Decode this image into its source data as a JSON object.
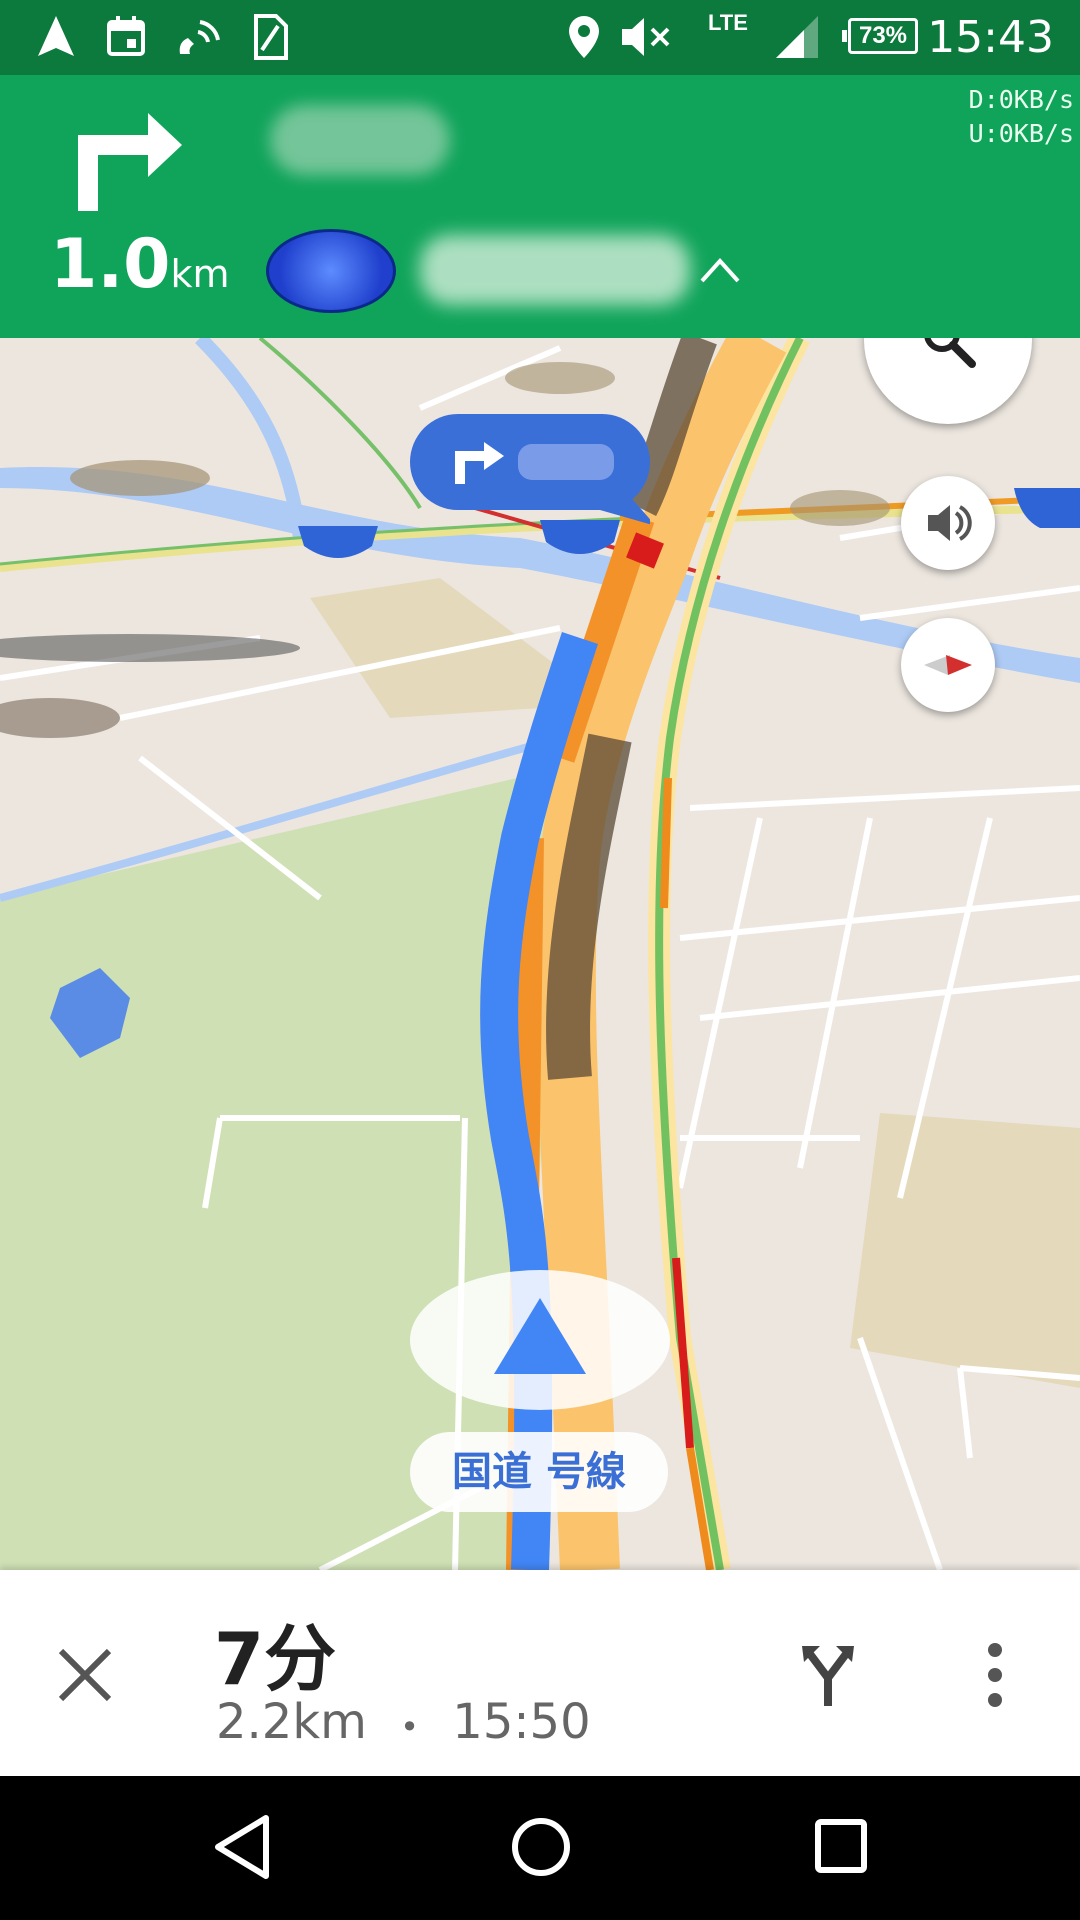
{
  "status_bar": {
    "time": "15:43",
    "battery": "73%",
    "network": "LTE",
    "icons": [
      "navigation-arrow-icon",
      "calendar-icon",
      "wifi-calling-icon",
      "sim-icon",
      "location-icon",
      "mute-icon",
      "signal-icon",
      "battery-icon"
    ]
  },
  "header": {
    "distance_value": "1.0",
    "distance_unit": "km",
    "network_speed_down": "D:0KB/s",
    "network_speed_up": "U:0KB/s",
    "accent_color": "#10a45a"
  },
  "map": {
    "road_label": "国道 号線",
    "route_color": "#4285f4"
  },
  "bottom_bar": {
    "eta_duration": "7分",
    "eta_distance": "2.2km",
    "separator": "•",
    "eta_arrival": "15:50"
  }
}
